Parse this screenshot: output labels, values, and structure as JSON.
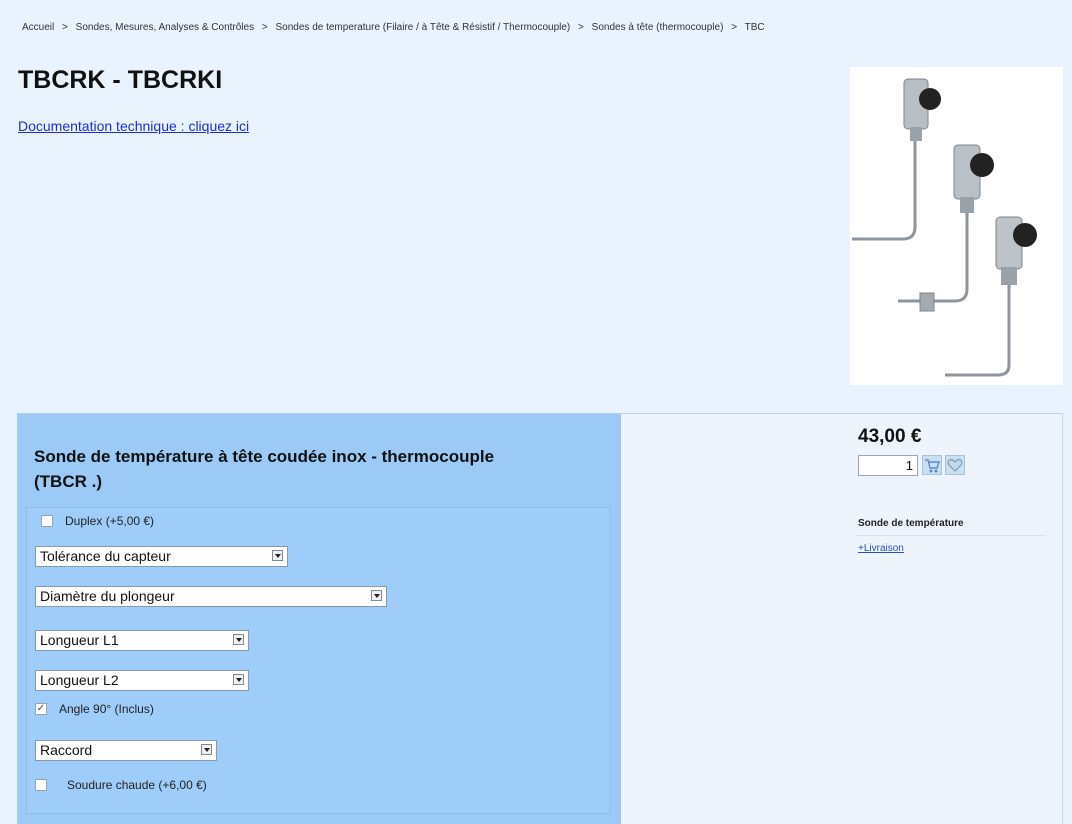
{
  "breadcrumb": [
    "Accueil",
    "Sondes, Mesures, Analyses & Contrôles",
    "Sondes de temperature (Filaire / à Tête & Résistif / Thermocouple)",
    "Sondes à tête (thermocouple)",
    "TBC"
  ],
  "breadcrumb_separator": ">",
  "page": {
    "title": "TBCRK - TBCRKI",
    "doc_link": "Documentation technique : cliquez ici"
  },
  "product": {
    "name": "Sonde de température à tête coudée inox - thermocouple (TBCR .)",
    "price": "43,00 €",
    "quantity": "1",
    "side_title": "Sonde de température",
    "delivery_link": "+Livraison",
    "image_icon": "thermocouple-probes-image"
  },
  "options": {
    "duplex": "Duplex (+5,00 €)",
    "tolerance": "Tolérance du capteur",
    "diametre": "Diamètre du plongeur",
    "longueur_l1": "Longueur L1",
    "longueur_l2": "Longueur L2",
    "angle": "Angle 90° (Inclus)",
    "angle_checked": true,
    "raccord": "Raccord",
    "soudure": "Soudure chaude (+6,00 €)"
  },
  "colors": {
    "page_bg": "#e9f3fd",
    "left_panel": "#9ccaf6",
    "link": "#1d2fd0"
  }
}
